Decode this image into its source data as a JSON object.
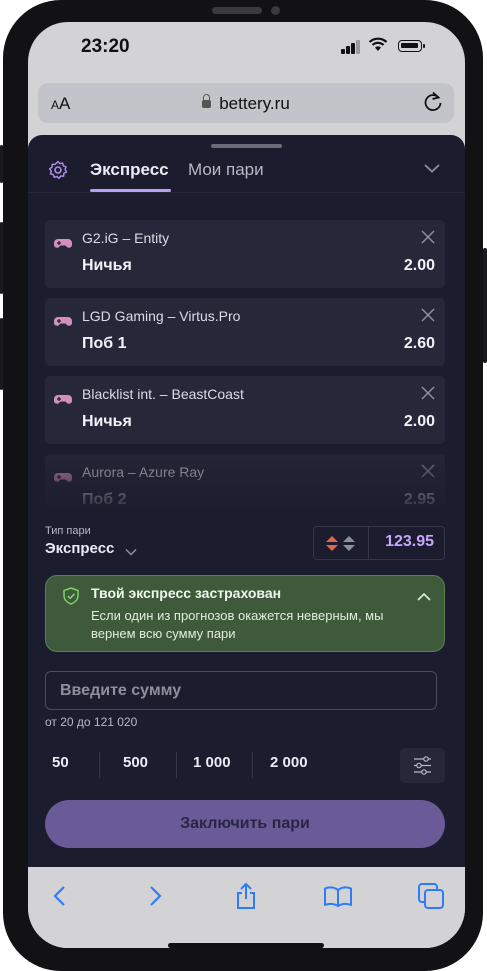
{
  "status_bar": {
    "time": "23:20",
    "signal_icon": "cellular-signal-icon",
    "wifi_icon": "wifi-icon",
    "battery_icon": "battery-icon"
  },
  "browser": {
    "text_size_label": "AA",
    "url": "bettery.ru",
    "lock_icon": "lock-icon",
    "reload_icon": "reload-icon"
  },
  "betslip": {
    "settings_icon": "gear-icon",
    "tabs": [
      {
        "label": "Экспресс",
        "active": true
      },
      {
        "label": "Мои пари",
        "active": false
      }
    ],
    "collapse_icon": "chevron-down-icon",
    "accent_color": "#b69ff5",
    "bets": [
      {
        "match": "G2.iG – Entity",
        "outcome": "Ничья",
        "odds": "2.00"
      },
      {
        "match": "LGD Gaming – Virtus.Pro",
        "outcome": "Поб 1",
        "odds": "2.60"
      },
      {
        "match": "Blacklist int. – BeastCoast",
        "outcome": "Ничья",
        "odds": "2.00"
      },
      {
        "match": "Aurora – Azure Ray",
        "outcome": "Поб 2",
        "odds": "2.95"
      }
    ],
    "bet_type": {
      "label": "Тип пари",
      "value": "Экспресс"
    },
    "total_odds": "123.95",
    "insurance": {
      "title": "Твой экспресс застрахован",
      "text": "Если один из прогнозов окажется неверным, мы вернем всю сумму пари",
      "color": "#3e5a3b"
    },
    "amount": {
      "placeholder": "Введите сумму",
      "value": "",
      "range": "от 20 до 121 020"
    },
    "quick_amounts": [
      "50",
      "500",
      "1 000",
      "2 000"
    ],
    "quick_settings_icon": "sliders-icon",
    "submit_label": "Заключить пари"
  },
  "toolbar": {
    "back_icon": "back-icon",
    "forward_icon": "forward-icon",
    "share_icon": "share-icon",
    "bookmarks_icon": "book-icon",
    "tabs_icon": "tabs-icon"
  }
}
